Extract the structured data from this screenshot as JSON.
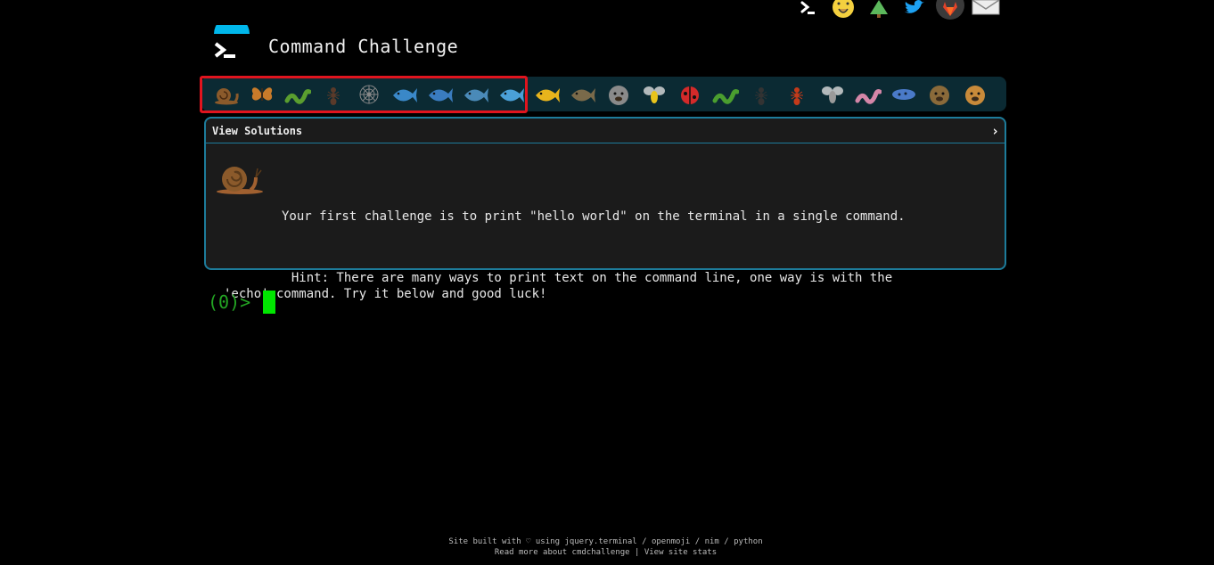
{
  "header": {
    "title": "Command Challenge"
  },
  "social": [
    {
      "icon": "terminal-icon"
    },
    {
      "icon": "face-icon"
    },
    {
      "icon": "tree-icon"
    },
    {
      "icon": "twitter-icon"
    },
    {
      "icon": "gitlab-icon"
    },
    {
      "icon": "mail-icon"
    }
  ],
  "challenges": [
    {
      "icon": "snail-icon",
      "color": "#8b5a2b"
    },
    {
      "icon": "butterfly-icon",
      "color": "#c97b2a"
    },
    {
      "icon": "caterpillar-icon",
      "color": "#5a9e2f"
    },
    {
      "icon": "ant-icon",
      "color": "#5a3a2a"
    },
    {
      "icon": "spider-web-icon",
      "color": "#888888"
    },
    {
      "icon": "whale-icon",
      "color": "#3a88c8"
    },
    {
      "icon": "shark-icon",
      "color": "#3a7cc0"
    },
    {
      "icon": "dolphin-icon",
      "color": "#4a8ab8"
    },
    {
      "icon": "fish-icon",
      "color": "#4aa0d8"
    },
    {
      "icon": "tropical-fish-icon",
      "color": "#e8b41c"
    },
    {
      "icon": "blowfish-icon",
      "color": "#7a6a4a"
    },
    {
      "icon": "wolf-icon",
      "color": "#8a8a8a"
    },
    {
      "icon": "bee-icon",
      "color": "#e8c41c"
    },
    {
      "icon": "ladybug-icon",
      "color": "#d42a2a"
    },
    {
      "icon": "cricket-icon",
      "color": "#4a9e2f"
    },
    {
      "icon": "spider-icon",
      "color": "#333333"
    },
    {
      "icon": "scorpion-icon",
      "color": "#c43a1a"
    },
    {
      "icon": "fly-icon",
      "color": "#9a9a9a"
    },
    {
      "icon": "worm-icon",
      "color": "#d486a8"
    },
    {
      "icon": "microbe-icon",
      "color": "#4a7ac8"
    },
    {
      "icon": "monkey-icon",
      "color": "#8a6a3a"
    },
    {
      "icon": "dog-icon",
      "color": "#c88a3a"
    }
  ],
  "panel": {
    "toggle_label": "View Solutions",
    "chevron": "›",
    "icon": "snail-icon",
    "text1": "Your first challenge is to print \"hello world\" on the terminal in a single command.",
    "text2_line1": "         Hint: There are many ways to print text on the command line, one way is with the",
    "text2_line2": "'echo' command. Try it below and good luck!"
  },
  "terminal": {
    "prompt": "(0)>"
  },
  "footer": {
    "line1_prefix": "Site built with ♡ using ",
    "jquery": "jquery.terminal",
    "sep1": " / ",
    "openmoji": "openmoji",
    "sep2": " / ",
    "nim": "nim",
    "sep3": " / ",
    "python": "python",
    "read_more": "Read more about cmdchallenge",
    "divider": " | ",
    "stats": "View site stats"
  }
}
